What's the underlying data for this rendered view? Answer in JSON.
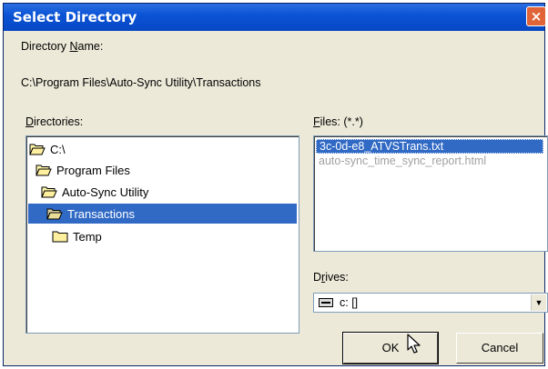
{
  "window": {
    "title": "Select Directory",
    "close_icon": "×"
  },
  "directory_name": {
    "label_pre": "Directory ",
    "label_key": "N",
    "label_post": "ame:",
    "path": "C:\\Program Files\\Auto-Sync Utility\\Transactions"
  },
  "directories": {
    "label_key": "D",
    "label_post": "irectories:",
    "items": [
      {
        "label": "C:\\",
        "state": "open"
      },
      {
        "label": "Program Files",
        "state": "open"
      },
      {
        "label": "Auto-Sync Utility",
        "state": "open"
      },
      {
        "label": "Transactions",
        "state": "open-selected"
      },
      {
        "label": "Temp",
        "state": "closed"
      }
    ]
  },
  "files": {
    "label_key": "F",
    "label_post": "iles: (*.*)",
    "items": [
      {
        "name": "3c-0d-e8_ATVSTrans.txt",
        "selected": true
      },
      {
        "name": "auto-sync_time_sync_report.html",
        "selected": false
      }
    ]
  },
  "drives": {
    "label_pre": "D",
    "label_key": "r",
    "label_post": "ives:",
    "selected": "c: []"
  },
  "buttons": {
    "ok": "OK",
    "cancel": "Cancel"
  },
  "colors": {
    "title_bar": "#0b54d6",
    "selection": "#316ac5",
    "dialog_bg": "#ece9d8"
  }
}
